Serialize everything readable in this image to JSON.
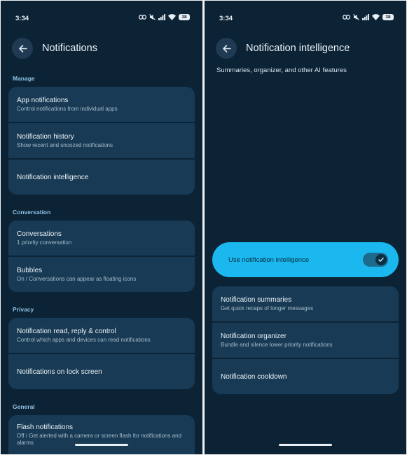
{
  "left": {
    "status": {
      "time": "3:34",
      "battery": "38"
    },
    "title": "Notifications",
    "sections": {
      "manage": {
        "label": "Manage",
        "items": [
          {
            "title": "App notifications",
            "subtitle": "Control notifications from individual apps"
          },
          {
            "title": "Notification history",
            "subtitle": "Show recent and snoozed notifications"
          },
          {
            "title": "Notification intelligence"
          }
        ]
      },
      "conversation": {
        "label": "Conversation",
        "items": [
          {
            "title": "Conversations",
            "subtitle": "1 priority conversation"
          },
          {
            "title": "Bubbles",
            "subtitle": "On / Conversations can appear as floating icons"
          }
        ]
      },
      "privacy": {
        "label": "Privacy",
        "items": [
          {
            "title": "Notification read, reply & control",
            "subtitle": "Control which apps and devices can read notifications"
          },
          {
            "title": "Notifications on lock screen"
          }
        ]
      },
      "general": {
        "label": "General",
        "items": [
          {
            "title": "Flash notifications",
            "subtitle": "Off / Get alerted with a camera or screen flash for notifications and alarms"
          }
        ]
      }
    }
  },
  "right": {
    "status": {
      "time": "3:34",
      "battery": "38"
    },
    "title": "Notification intelligence",
    "subtitle": "Summaries, organizer, and other AI features",
    "toggle": {
      "label": "Use notification intelligence",
      "state": "on"
    },
    "items": [
      {
        "title": "Notification summaries",
        "subtitle": "Get quick recaps of longer messages"
      },
      {
        "title": "Notification organizer",
        "subtitle": "Bundle and silence lower priority notifications"
      },
      {
        "title": "Notification cooldown"
      }
    ]
  },
  "colors": {
    "background": "#0c2336",
    "card": "#183a54",
    "accent_toggle": "#1ab8ef",
    "section_label": "#8ec1e4"
  }
}
